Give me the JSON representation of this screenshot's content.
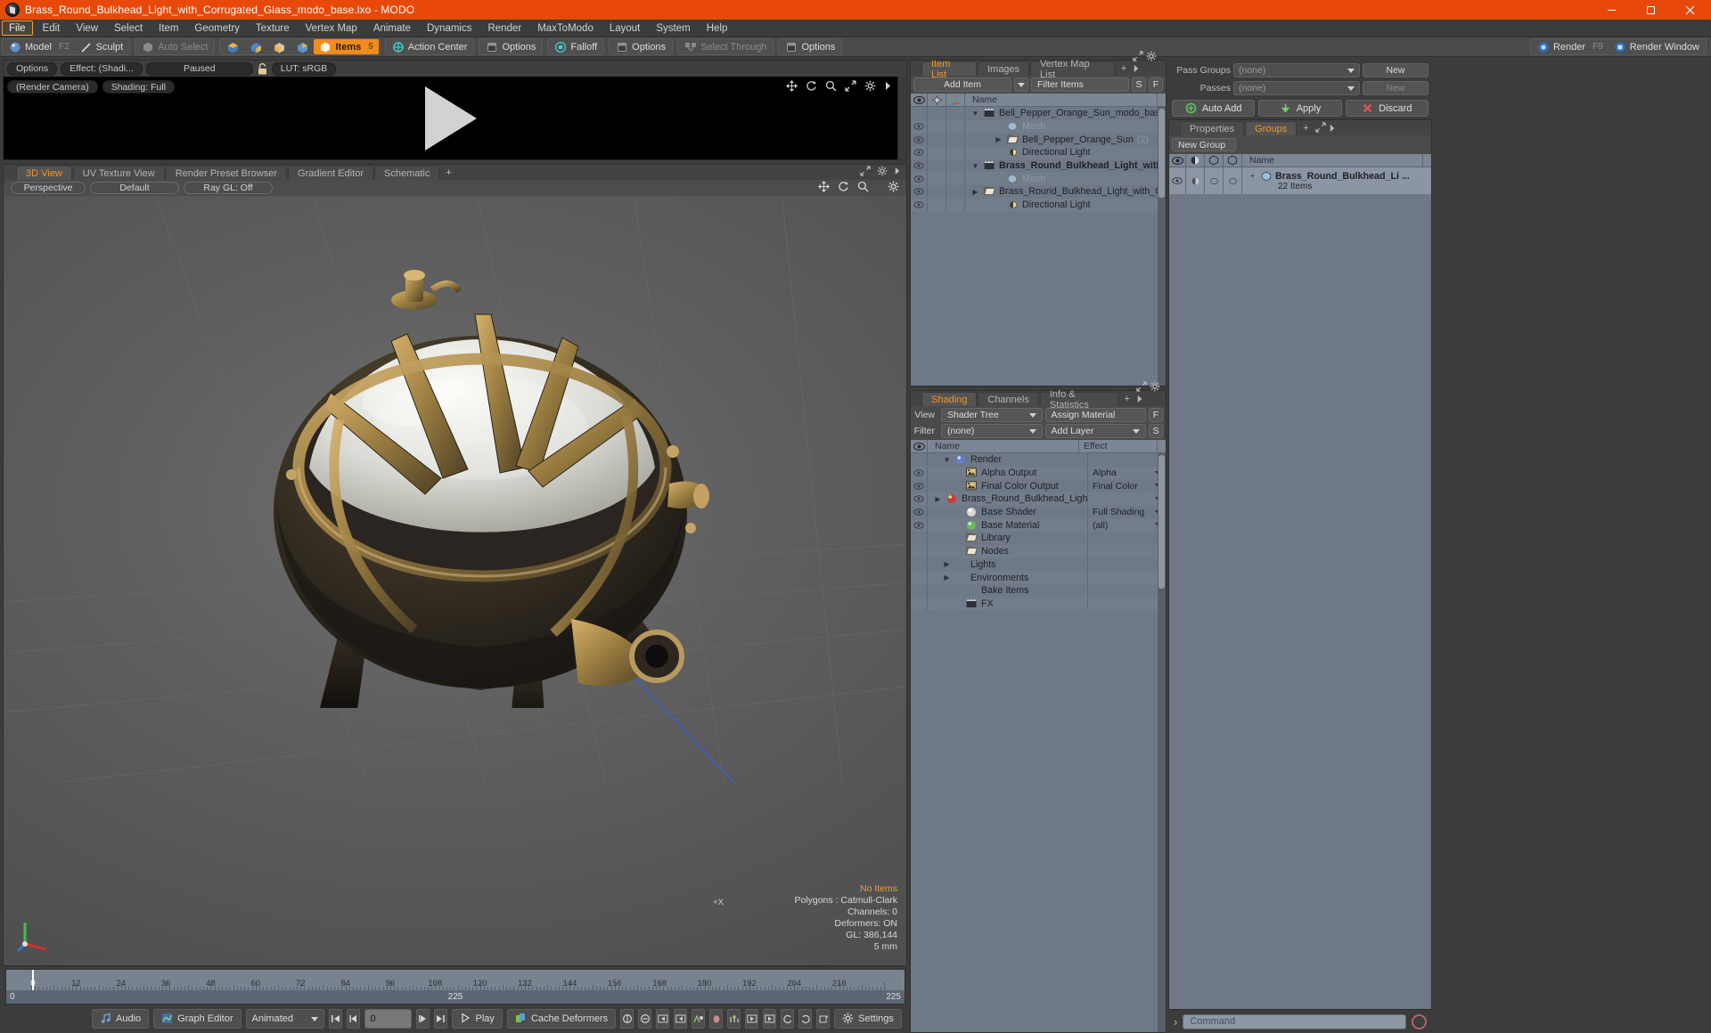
{
  "window": {
    "title": "Brass_Round_Bulkhead_Light_with_Corrugated_Glass_modo_base.lxo - MODO",
    "minimize": "–",
    "maximize": "❐",
    "close": "✕"
  },
  "menubar": {
    "items": [
      "File",
      "Edit",
      "View",
      "Select",
      "Item",
      "Geometry",
      "Texture",
      "Vertex Map",
      "Animate",
      "Dynamics",
      "Render",
      "MaxToModo",
      "Layout",
      "System",
      "Help"
    ],
    "active": "File"
  },
  "modebar": {
    "model": "Model",
    "model_hint": "F2",
    "sculpt": "Sculpt",
    "auto_select": "Auto Select",
    "items": "Items",
    "items_hint": "5",
    "action_center": "Action Center",
    "options1": "Options",
    "falloff": "Falloff",
    "options2": "Options",
    "select_through": "Select Through",
    "options3": "Options",
    "render": "Render",
    "render_hint": "F9",
    "render_window": "Render Window"
  },
  "preview": {
    "options": "Options",
    "effect": "Effect: (Shadi...",
    "paused": "Paused",
    "lut": "LUT: sRGB",
    "render_camera": "(Render Camera)",
    "shading": "Shading: Full"
  },
  "viewport": {
    "tabs": [
      "3D View",
      "UV Texture View",
      "Render Preset Browser",
      "Gradient Editor",
      "Schematic"
    ],
    "tab_plus": "+",
    "selected_tab": "3D View",
    "perspective": "Perspective",
    "default": "Default",
    "raygl": "Ray GL: Off",
    "axis_label": "+X",
    "stats": {
      "items": "No Items",
      "polygons": "Polygons : Catmull-Clark",
      "channels": "Channels: 0",
      "deformers": "Deformers: ON",
      "gl": "GL: 386,144",
      "scale": "5 mm"
    }
  },
  "timeline": {
    "ticks": [
      0,
      12,
      24,
      36,
      48,
      60,
      72,
      84,
      96,
      108,
      120,
      132,
      144,
      156,
      168,
      180,
      192,
      204,
      216
    ],
    "range_start": "0",
    "range_mid": "225",
    "range_end": "225",
    "playhead": 0,
    "max": 228
  },
  "bottombar": {
    "audio": "Audio",
    "graph_editor": "Graph Editor",
    "animated": "Animated",
    "frame": "0",
    "play": "Play",
    "cache_deformers": "Cache Deformers",
    "settings": "Settings"
  },
  "item_list": {
    "tabs": [
      "Item List",
      "Images",
      "Vertex Map List"
    ],
    "tab_plus": "+",
    "selected_tab": "Item List",
    "add_item": "Add Item",
    "filter_items": "Filter Items",
    "btn_s": "S",
    "btn_f": "F",
    "column_name": "Name",
    "rows": [
      {
        "label": "Bell_Pepper_Orange_Sun_modo_base.lxo*",
        "icon": "scene-icon",
        "indent": 0,
        "twisty": "▼",
        "eye": false,
        "dim": false,
        "bold": false,
        "suffix": ""
      },
      {
        "label": "Mesh",
        "icon": "mesh-icon",
        "indent": 1,
        "twisty": "",
        "eye": true,
        "dim": true,
        "bold": false,
        "suffix": ""
      },
      {
        "label": "Bell_Pepper_Orange_Sun",
        "icon": "folder-icon",
        "indent": 1,
        "twisty": "▶",
        "eye": true,
        "dim": false,
        "bold": false,
        "suffix": "(2)"
      },
      {
        "label": "Directional Light",
        "icon": "light-icon",
        "indent": 1,
        "twisty": "",
        "eye": true,
        "dim": false,
        "bold": false,
        "suffix": ""
      },
      {
        "label": "Brass_Round_Bulkhead_Light_with_...",
        "icon": "scene-icon",
        "indent": 0,
        "twisty": "▼",
        "eye": true,
        "dim": false,
        "bold": true,
        "suffix": ""
      },
      {
        "label": "Mesh",
        "icon": "mesh-icon",
        "indent": 1,
        "twisty": "",
        "eye": true,
        "dim": true,
        "bold": false,
        "suffix": ""
      },
      {
        "label": "Brass_Round_Bulkhead_Light_with_Corr...",
        "icon": "folder-icon",
        "indent": 1,
        "twisty": "▶",
        "eye": true,
        "dim": false,
        "bold": false,
        "suffix": ""
      },
      {
        "label": "Directional Light",
        "icon": "light-icon",
        "indent": 1,
        "twisty": "",
        "eye": true,
        "dim": false,
        "bold": false,
        "suffix": ""
      }
    ]
  },
  "shading": {
    "tabs": [
      "Shading",
      "Channels",
      "Info & Statistics"
    ],
    "tab_plus": "+",
    "selected_tab": "Shading",
    "view_label": "View",
    "view_value": "Shader Tree",
    "assign_material": "Assign Material",
    "btn_f": "F",
    "filter_label": "Filter",
    "filter_value": "(none)",
    "add_layer": "Add Layer",
    "btn_s": "S",
    "col_name": "Name",
    "col_effect": "Effect",
    "rows": [
      {
        "label": "Render",
        "effect": "",
        "icon": "sphere-blue-icon",
        "indent": 0,
        "twisty": "▼",
        "eye": false,
        "drop": false
      },
      {
        "label": "Alpha Output",
        "effect": "Alpha",
        "icon": "image-icon",
        "indent": 1,
        "twisty": "",
        "eye": true,
        "drop": true
      },
      {
        "label": "Final Color Output",
        "effect": "Final Color",
        "icon": "image-icon",
        "indent": 1,
        "twisty": "",
        "eye": true,
        "drop": true
      },
      {
        "label": "Brass_Round_Bulkhead_Ligh...",
        "effect": "",
        "icon": "sphere-red-icon",
        "indent": 1,
        "twisty": "▶",
        "eye": true,
        "drop": true
      },
      {
        "label": "Base Shader",
        "effect": "Full Shading",
        "icon": "sphere-white-icon",
        "indent": 1,
        "twisty": "",
        "eye": true,
        "drop": true
      },
      {
        "label": "Base Material",
        "effect": "(all)",
        "icon": "sphere-green-icon",
        "indent": 1,
        "twisty": "",
        "eye": true,
        "drop": true
      },
      {
        "label": "Library",
        "effect": "",
        "icon": "folder-icon",
        "indent": 1,
        "twisty": "",
        "eye": false,
        "drop": false
      },
      {
        "label": "Nodes",
        "effect": "",
        "icon": "folder-icon",
        "indent": 1,
        "twisty": "",
        "eye": false,
        "drop": false
      },
      {
        "label": "Lights",
        "effect": "",
        "icon": "none",
        "indent": 0,
        "twisty": "▶",
        "eye": false,
        "drop": false
      },
      {
        "label": "Environments",
        "effect": "",
        "icon": "none",
        "indent": 0,
        "twisty": "▶",
        "eye": false,
        "drop": false
      },
      {
        "label": "Bake Items",
        "effect": "",
        "icon": "none",
        "indent": 1,
        "twisty": "",
        "eye": false,
        "drop": false
      },
      {
        "label": "FX",
        "effect": "",
        "icon": "fx-icon",
        "indent": 1,
        "twisty": "",
        "eye": false,
        "drop": false
      }
    ]
  },
  "passes": {
    "pass_groups_label": "Pass Groups",
    "pass_groups_value": "(none)",
    "pass_groups_new": "New",
    "passes_label": "Passes",
    "passes_value": "(none)",
    "passes_new": "New",
    "auto_add": "Auto Add",
    "apply": "Apply",
    "discard": "Discard"
  },
  "groups": {
    "tabs": [
      "Properties",
      "Groups"
    ],
    "tab_plus": "+",
    "selected_tab": "Groups",
    "new_group": "New Group",
    "col_name": "Name",
    "row_label": "Brass_Round_Bulkhead_Li ...",
    "row_sub": "22 Items"
  },
  "command": {
    "prompt": "›",
    "placeholder": "Command"
  },
  "colors": {
    "title_bar": "#e8490a",
    "accent": "#f09526",
    "panel_bg": "#6e7886",
    "chrome": "#3c3c3c"
  }
}
